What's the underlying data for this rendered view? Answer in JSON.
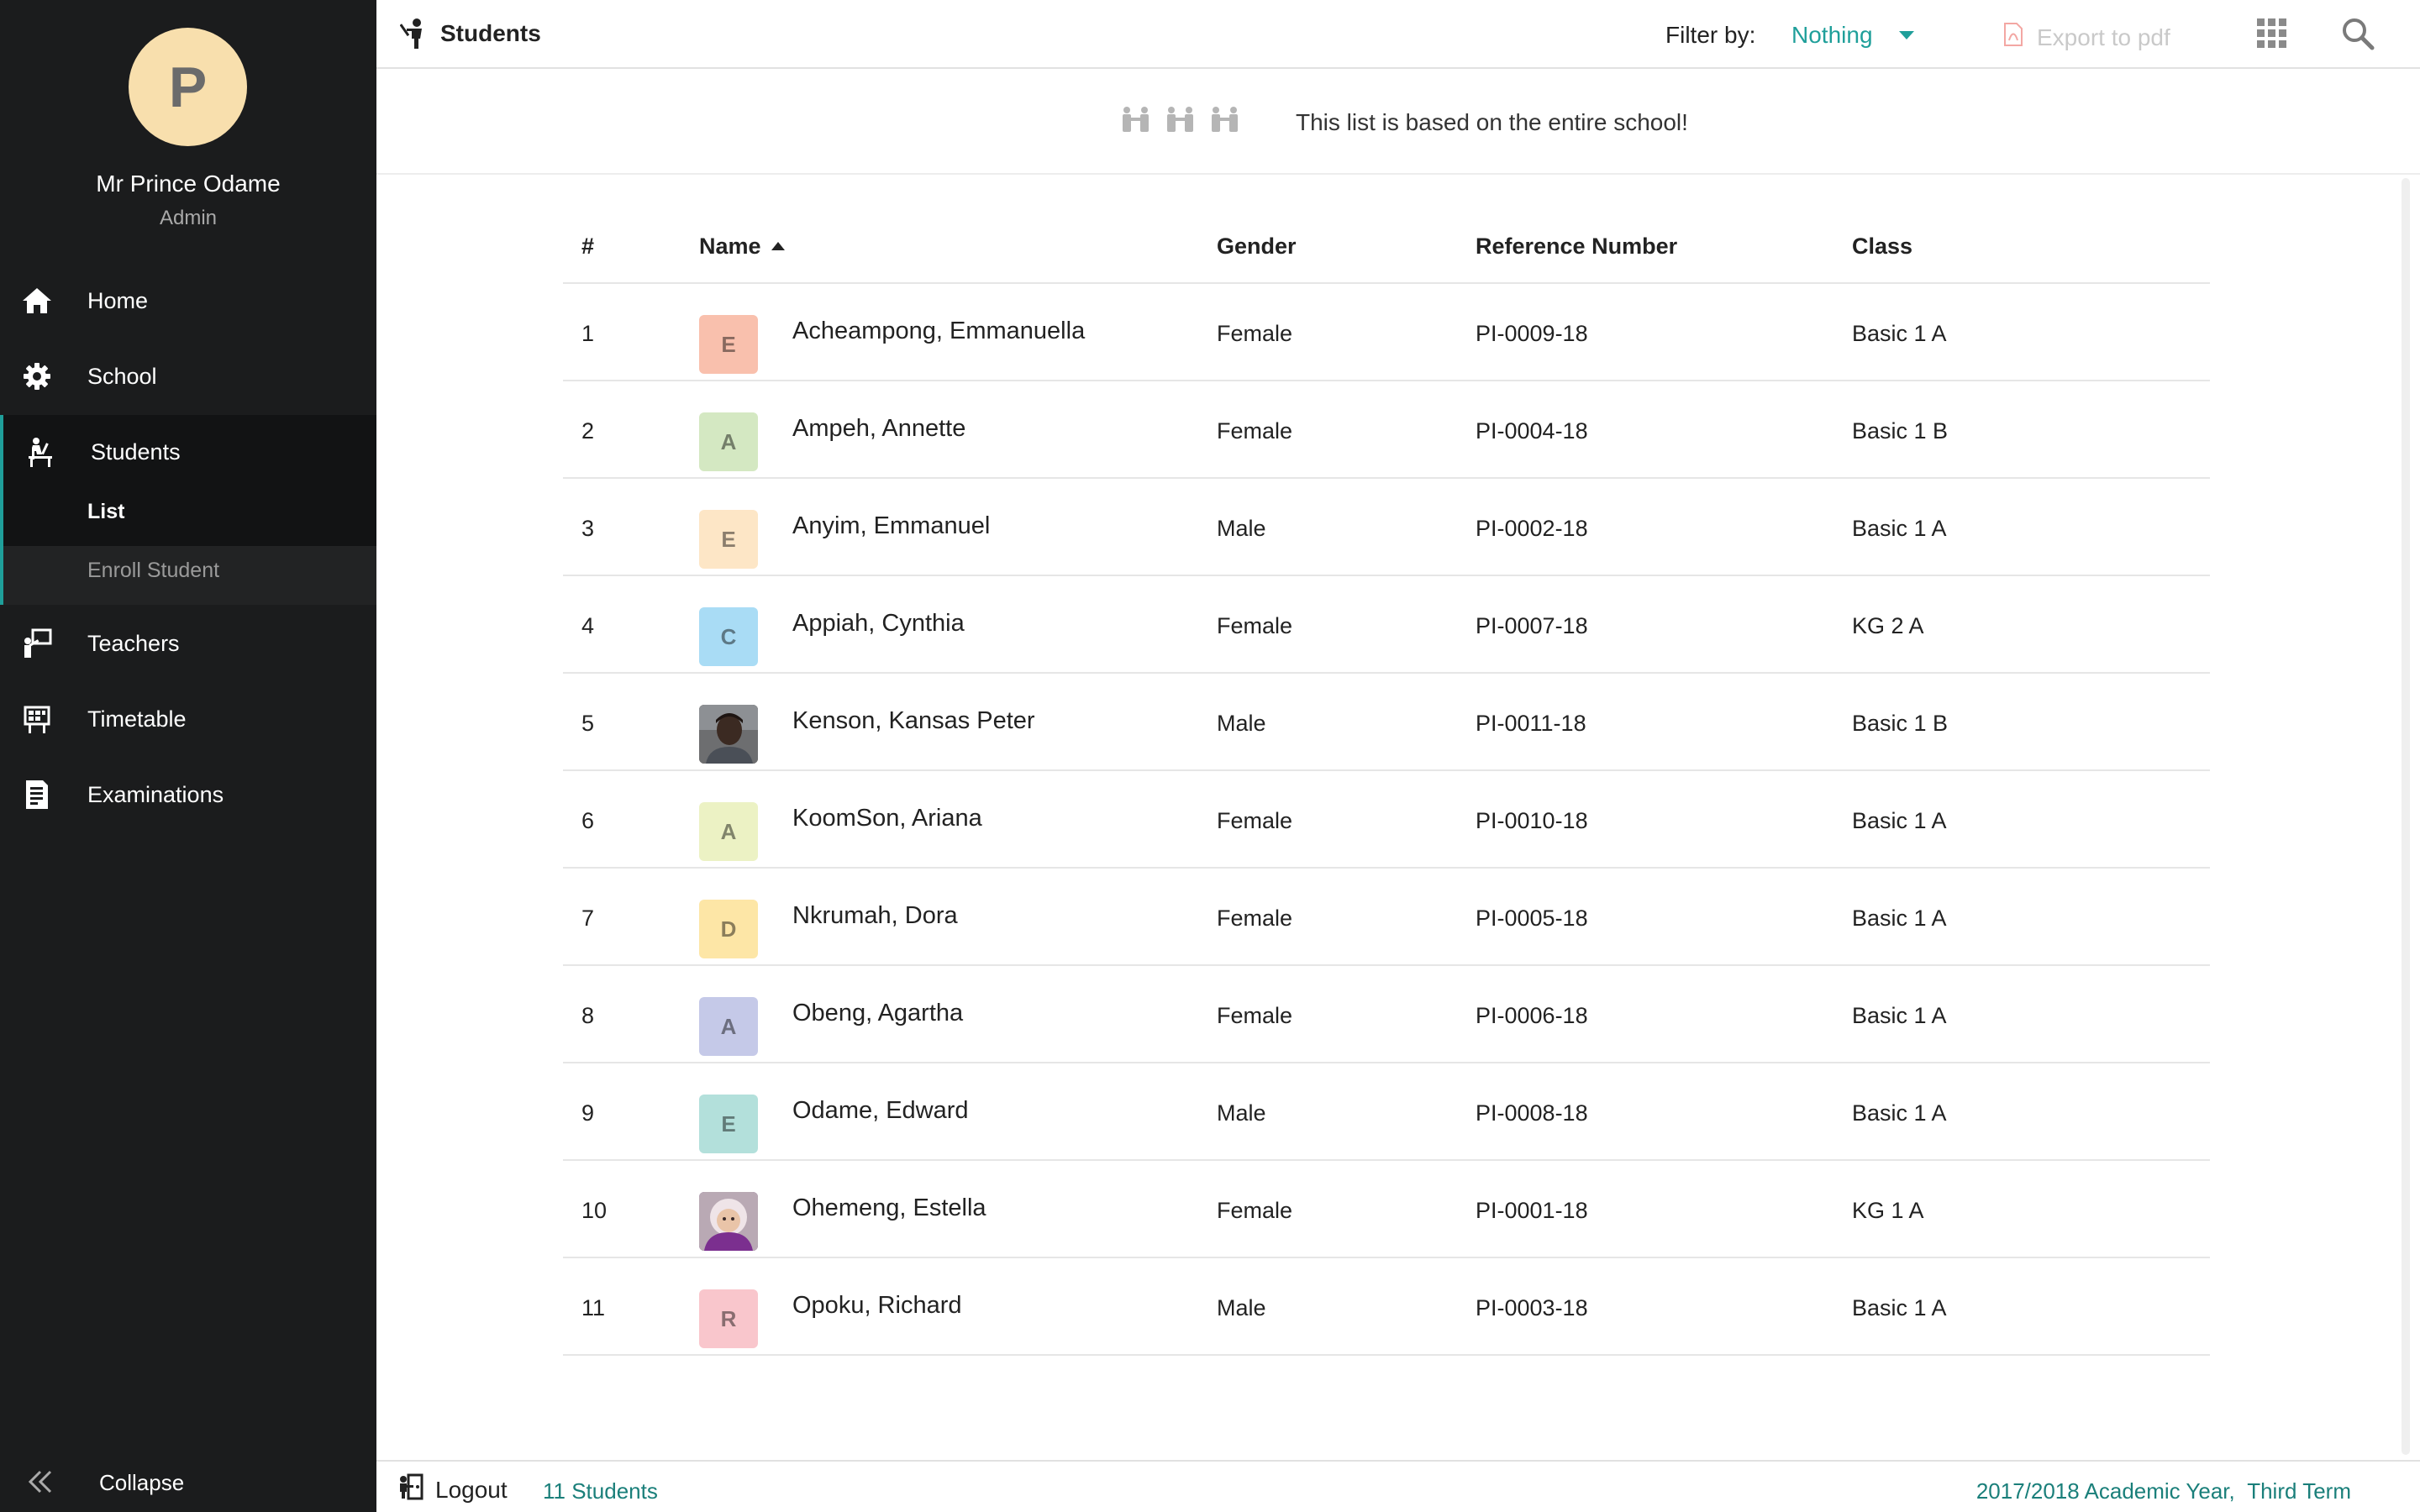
{
  "user": {
    "initial": "P",
    "name": "Mr Prince Odame",
    "role": "Admin"
  },
  "nav": {
    "home": "Home",
    "school": "School",
    "students": "Students",
    "list": "List",
    "enroll": "Enroll Student",
    "teachers": "Teachers",
    "timetable": "Timetable",
    "examinations": "Examinations",
    "collapse": "Collapse"
  },
  "header": {
    "title": "Students",
    "filter_label": "Filter by:",
    "filter_value": "Nothing",
    "export_label": "Export to pdf"
  },
  "notice": {
    "message": "This list is based on the entire school!"
  },
  "table": {
    "columns": {
      "num": "#",
      "name": "Name",
      "gender": "Gender",
      "ref": "Reference Number",
      "class": "Class"
    },
    "rows": [
      {
        "num": "1",
        "initial": "E",
        "avatar_color": "#f9c0ad",
        "photo": "",
        "name": "Acheampong, Emmanuella",
        "gender": "Female",
        "ref": "PI-0009-18",
        "class": "Basic 1 A"
      },
      {
        "num": "2",
        "initial": "A",
        "avatar_color": "#d4e8c2",
        "photo": "",
        "name": "Ampeh, Annette",
        "gender": "Female",
        "ref": "PI-0004-18",
        "class": "Basic 1 B"
      },
      {
        "num": "3",
        "initial": "E",
        "avatar_color": "#fde6c6",
        "photo": "",
        "name": "Anyim, Emmanuel",
        "gender": "Male",
        "ref": "PI-0002-18",
        "class": "Basic 1 A"
      },
      {
        "num": "4",
        "initial": "C",
        "avatar_color": "#a9dcf5",
        "photo": "",
        "name": "Appiah, Cynthia",
        "gender": "Female",
        "ref": "PI-0007-18",
        "class": "KG 2 A"
      },
      {
        "num": "5",
        "initial": "",
        "avatar_color": "#5a4a42",
        "photo": "boy",
        "name": "Kenson, Kansas Peter",
        "gender": "Male",
        "ref": "PI-0011-18",
        "class": "Basic 1 B"
      },
      {
        "num": "6",
        "initial": "A",
        "avatar_color": "#ecf2c4",
        "photo": "",
        "name": "KoomSon, Ariana",
        "gender": "Female",
        "ref": "PI-0010-18",
        "class": "Basic 1 A"
      },
      {
        "num": "7",
        "initial": "D",
        "avatar_color": "#fde6a6",
        "photo": "",
        "name": "Nkrumah, Dora",
        "gender": "Female",
        "ref": "PI-0005-18",
        "class": "Basic 1 A"
      },
      {
        "num": "8",
        "initial": "A",
        "avatar_color": "#c5c9e8",
        "photo": "",
        "name": "Obeng, Agartha",
        "gender": "Female",
        "ref": "PI-0006-18",
        "class": "Basic 1 A"
      },
      {
        "num": "9",
        "initial": "E",
        "avatar_color": "#b3e0db",
        "photo": "",
        "name": "Odame, Edward",
        "gender": "Male",
        "ref": "PI-0008-18",
        "class": "Basic 1 A"
      },
      {
        "num": "10",
        "initial": "",
        "avatar_color": "#7a4a8a",
        "photo": "baby",
        "name": "Ohemeng, Estella",
        "gender": "Female",
        "ref": "PI-0001-18",
        "class": "KG 1 A"
      },
      {
        "num": "11",
        "initial": "R",
        "avatar_color": "#f9c6cc",
        "photo": "",
        "name": "Opoku, Richard",
        "gender": "Male",
        "ref": "PI-0003-18",
        "class": "Basic 1 A"
      }
    ]
  },
  "footer": {
    "logout": "Logout",
    "count": "11 Students",
    "year": "2017/2018 Academic Year,",
    "term": "Third Term"
  },
  "colors": {
    "accent": "#1f9f9a",
    "sidebar": "#1b1c1d",
    "avatar": "#f8dfad"
  }
}
